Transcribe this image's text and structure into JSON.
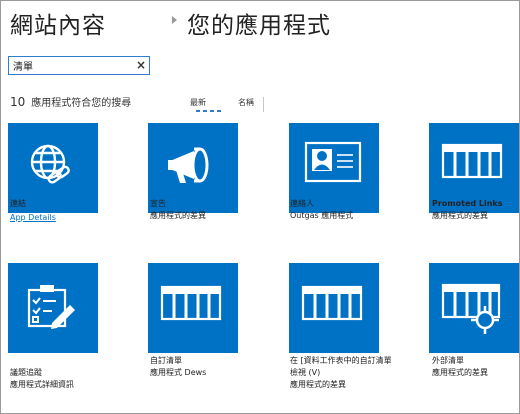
{
  "breadcrumb": {
    "site": "網站內容",
    "page": "您的應用程式"
  },
  "search": {
    "value": "清單",
    "clear_icon": "×"
  },
  "results": {
    "count": "10",
    "text": "應用程式符合您的搜尋"
  },
  "sort": {
    "newest": "最新",
    "name": "名稱"
  },
  "colors": {
    "tile": "#0072c6",
    "link": "#0072c6"
  },
  "apps": [
    {
      "icon": "globe-link-icon",
      "name": "連結",
      "desc": "App Details",
      "desc2": ""
    },
    {
      "icon": "megaphone-icon",
      "name": "宣告",
      "desc": "應用程式的差異",
      "desc2": ""
    },
    {
      "icon": "contact-card-icon",
      "name": "連絡人",
      "desc": "Outgas 應用程式",
      "desc2": ""
    },
    {
      "icon": "list-icon",
      "name": "Promoted Links",
      "desc": "應用程式的差異",
      "desc2": ""
    },
    {
      "icon": "checklist-clipboard-icon",
      "name": "議題追蹤",
      "desc": "應用程式詳細資訊",
      "desc2": ""
    },
    {
      "icon": "list-icon",
      "name": "自訂清單",
      "desc": "應用程式 Dews",
      "desc2": ""
    },
    {
      "icon": "list-icon",
      "name": "在 [資料工作表中的自訂清單",
      "desc": "檢視 (V)",
      "desc2": "應用程式的差異"
    },
    {
      "icon": "external-list-icon",
      "name": "外部清單",
      "desc": "應用程式的差異",
      "desc2": ""
    }
  ]
}
